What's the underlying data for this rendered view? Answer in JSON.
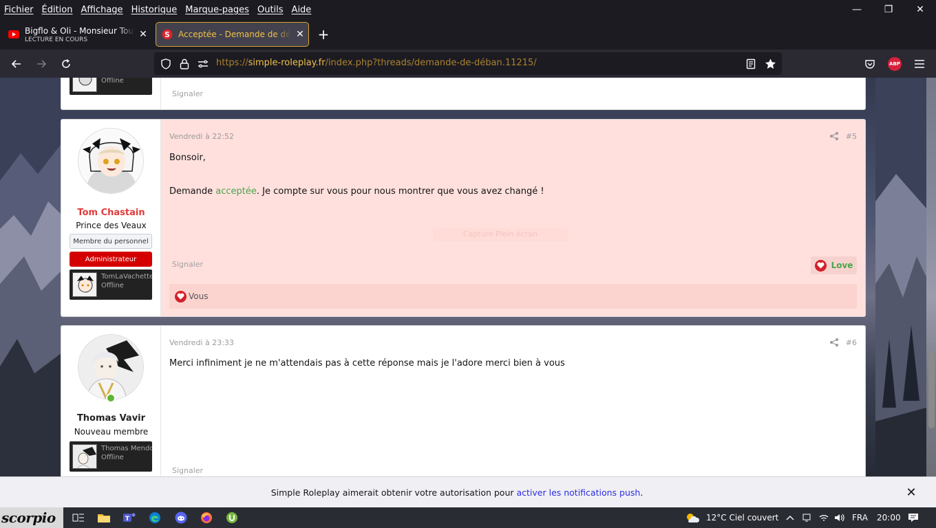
{
  "menu": [
    "Fichier",
    "Édition",
    "Affichage",
    "Historique",
    "Marque-pages",
    "Outils",
    "Aide"
  ],
  "window_controls": {
    "minimize": "—",
    "maximize": "❐",
    "close": "✕"
  },
  "tabs": [
    {
      "title": "Bigflo & Oli - Monsieur Tout Le",
      "subtitle": "LECTURE EN COURS",
      "icon": "youtube-icon",
      "close": "✕"
    },
    {
      "title": "Acceptée - Demande de déban",
      "icon": "simple-roleplay-favicon",
      "close": "✕"
    }
  ],
  "new_tab": "+",
  "url": {
    "scheme": "https://",
    "host": "simple-roleplay.fr",
    "path": "/index.php?threads/demande-de-déban.11215/"
  },
  "addon_badge": "ABP",
  "posts": [
    {
      "id": "partial-post",
      "char_status": "Offline",
      "report": "Signaler"
    },
    {
      "id": "post-5",
      "date": "Vendredi à 22:52",
      "number": "#5",
      "username": "Tom Chastain",
      "user_title": "Prince des Veaux",
      "banners": [
        "Membre du personnel",
        "Administrateur"
      ],
      "char_name": "TomLaVachette",
      "char_status": "Offline",
      "greeting": "Bonsoir,",
      "line_before": "Demande ",
      "line_link": "acceptée",
      "line_after": ". Je compte sur vous pour nous montrer que vous avez changé !",
      "ghost_label": "Capture Plein écran",
      "report": "Signaler",
      "love_label": "Love",
      "reactions_text": "Vous"
    },
    {
      "id": "post-6",
      "date": "Vendredi à 23:33",
      "number": "#6",
      "username": "Thomas Vavir",
      "user_title": "Nouveau membre",
      "char_name": "Thomas Mendo",
      "char_status": "Offline",
      "text": "Merci infiniment je ne m'attendais pas à cette réponse mais je l'adore merci bien à vous",
      "report": "Signaler"
    }
  ],
  "notification": {
    "before": "Simple Roleplay aimerait obtenir votre autorisation pour ",
    "link": "activer les notifications push",
    "after": ".",
    "close": "✕"
  },
  "taskbar": {
    "start_label": "scorpio",
    "weather": "12°C  Ciel couvert",
    "language": "FRA",
    "time": "20:00"
  },
  "colors": {
    "username_admin": "#e03c3c",
    "accent_green": "#4aa64a",
    "highlight_bg": "#ffe0dd",
    "active_tab_border": "#d9a530"
  }
}
